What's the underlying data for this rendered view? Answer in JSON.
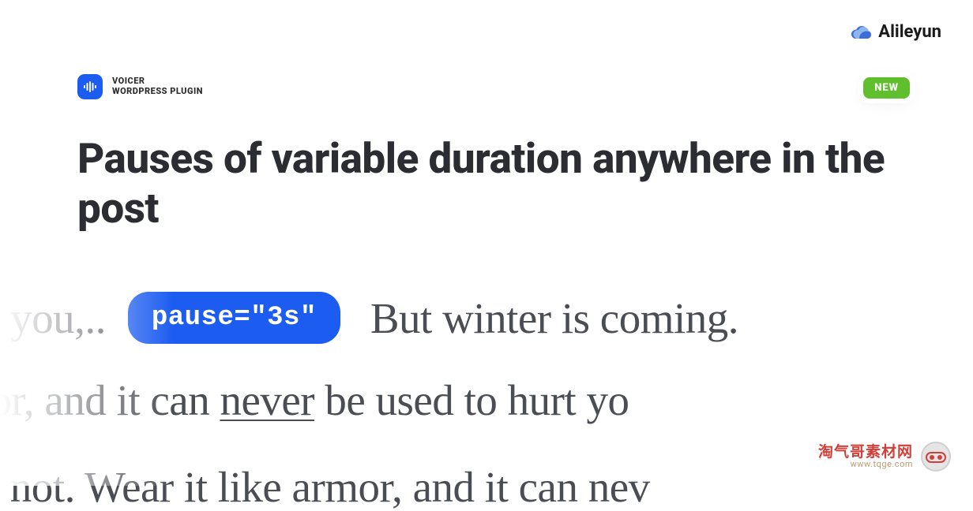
{
  "brand": {
    "name": "Alileyun"
  },
  "plugin": {
    "title": "VOICER",
    "subtitle": "WORDPRESS PLUGIN"
  },
  "badge": "NEW",
  "headline": "Pauses of variable duration anywhere in the post",
  "body": {
    "line1_before": "r you,..",
    "pill_code": "pause=\"3s\"",
    "line1_after": "But winter is coming.",
    "line2_before": "mor, and it can ",
    "line2_underlined": "never",
    "line2_after": " be used to hurt yo",
    "line3": "ll not. Wear it like armor, and it can nev"
  },
  "watermark": {
    "cn": "淘气哥素材网",
    "url": "www.tqge.com"
  }
}
